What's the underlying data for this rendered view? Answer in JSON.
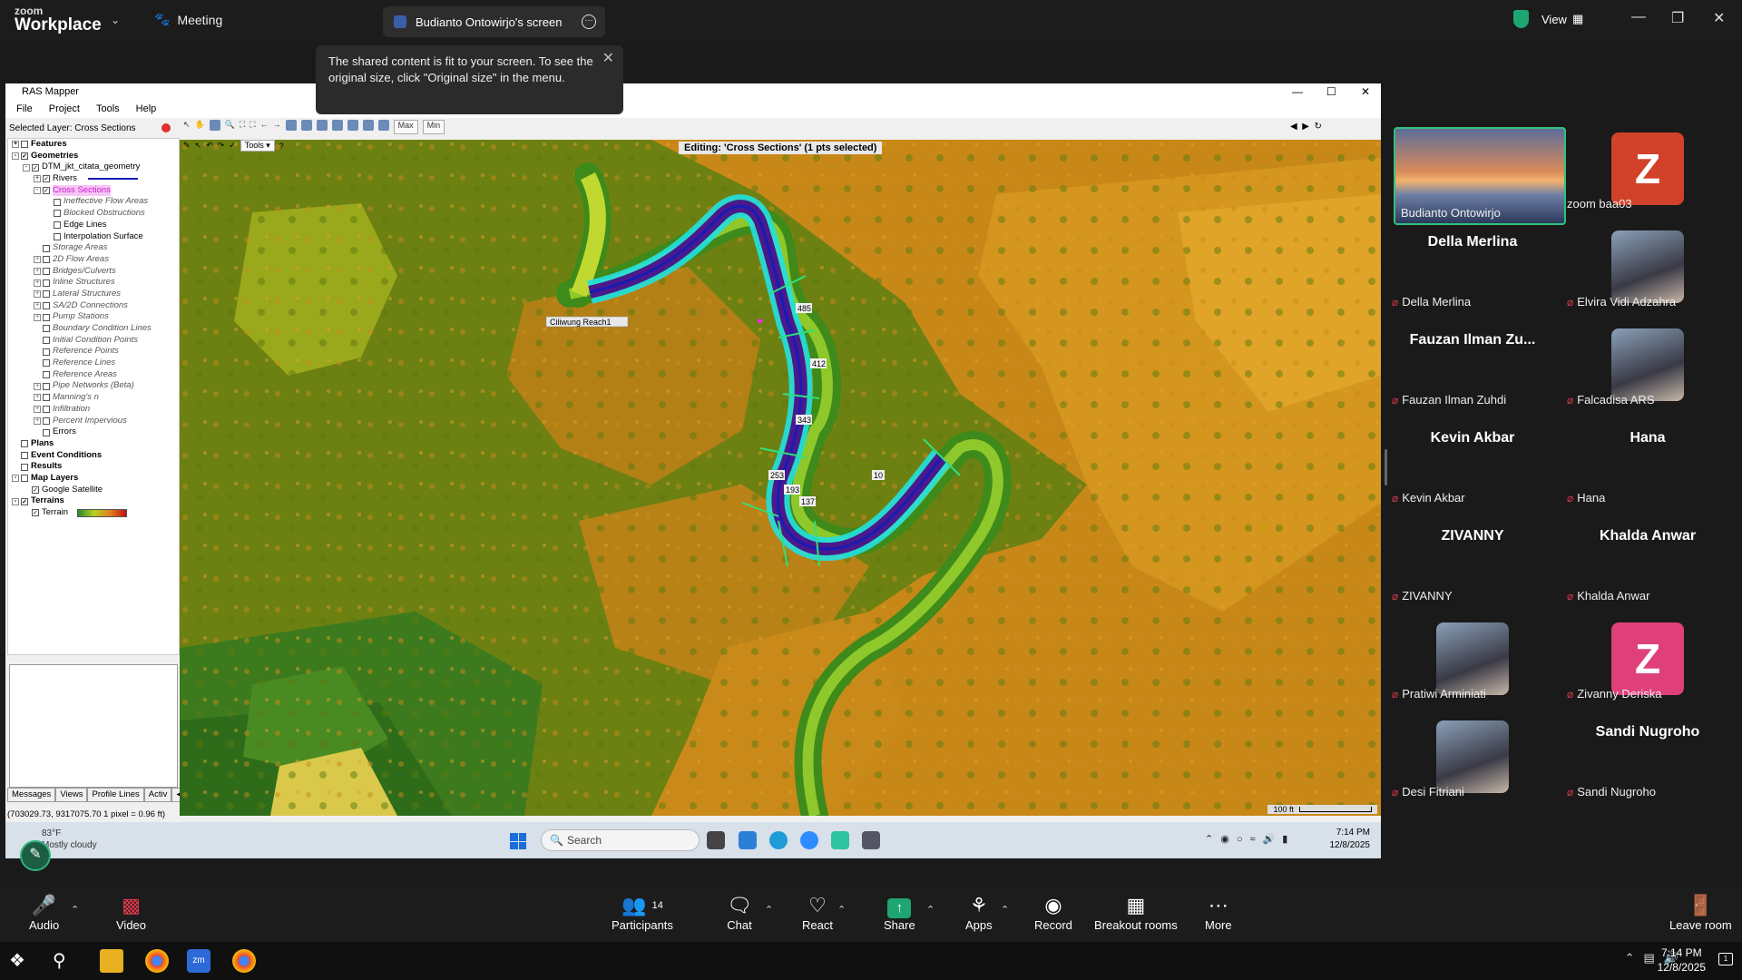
{
  "zoom_top": {
    "logo_top": "zoom",
    "logo_bottom": "Workplace",
    "meeting_label": "Meeting",
    "screen_tab_label": "Budianto Ontowirjo's screen",
    "view_label": "View"
  },
  "tooltip": {
    "text": "The shared content is fit to your screen. To see the original size, click \"Original size\" in the menu."
  },
  "ras": {
    "title": "RAS Mapper",
    "menu": [
      "File",
      "Project",
      "Tools",
      "Help"
    ],
    "selected_layer": "Selected Layer: Cross Sections",
    "tools_label": "Tools",
    "max_label": "Max",
    "min_label": "Min",
    "editing_label": "Editing: 'Cross Sections' (1 pts selected)",
    "scale_label": "100 ft",
    "coords": "(703029.73, 9317075.70  1 pixel = 0.96 ft)",
    "bottom_tabs": [
      "Messages",
      "Views",
      "Profile Lines",
      "Activ"
    ],
    "tree": [
      {
        "label": "Features",
        "indent": 0,
        "style": "bold",
        "toggle": "+",
        "checked": false
      },
      {
        "label": "Geometries",
        "indent": 0,
        "style": "bold",
        "toggle": "-",
        "checked": true
      },
      {
        "label": "DTM_jkt_citata_geometry",
        "indent": 1,
        "style": "",
        "toggle": "-",
        "checked": true
      },
      {
        "label": "Rivers",
        "indent": 2,
        "style": "",
        "toggle": "+",
        "checked": true,
        "swatch": "line"
      },
      {
        "label": "Cross Sections",
        "indent": 2,
        "style": "pink",
        "toggle": "-",
        "checked": true
      },
      {
        "label": "Ineffective Flow Areas",
        "indent": 3,
        "style": "ital",
        "toggle": "",
        "checked": false
      },
      {
        "label": "Blocked Obstructions",
        "indent": 3,
        "style": "ital",
        "toggle": "",
        "checked": false
      },
      {
        "label": "Edge Lines",
        "indent": 3,
        "style": "",
        "toggle": "",
        "checked": false
      },
      {
        "label": "Interpolation Surface",
        "indent": 3,
        "style": "",
        "toggle": "",
        "checked": false
      },
      {
        "label": "Storage Areas",
        "indent": 2,
        "style": "ital",
        "toggle": "",
        "checked": false
      },
      {
        "label": "2D Flow Areas",
        "indent": 2,
        "style": "ital",
        "toggle": "+",
        "checked": false
      },
      {
        "label": "Bridges/Culverts",
        "indent": 2,
        "style": "ital",
        "toggle": "+",
        "checked": false
      },
      {
        "label": "Inline Structures",
        "indent": 2,
        "style": "ital",
        "toggle": "+",
        "checked": false
      },
      {
        "label": "Lateral Structures",
        "indent": 2,
        "style": "ital",
        "toggle": "+",
        "checked": false
      },
      {
        "label": "SA/2D Connections",
        "indent": 2,
        "style": "ital",
        "toggle": "+",
        "checked": false
      },
      {
        "label": "Pump Stations",
        "indent": 2,
        "style": "ital",
        "toggle": "+",
        "checked": false
      },
      {
        "label": "Boundary Condition Lines",
        "indent": 2,
        "style": "ital",
        "toggle": "",
        "checked": false
      },
      {
        "label": "Initial Condition Points",
        "indent": 2,
        "style": "ital",
        "toggle": "",
        "checked": false
      },
      {
        "label": "Reference Points",
        "indent": 2,
        "style": "ital",
        "toggle": "",
        "checked": false
      },
      {
        "label": "Reference Lines",
        "indent": 2,
        "style": "ital",
        "toggle": "",
        "checked": false
      },
      {
        "label": "Reference Areas",
        "indent": 2,
        "style": "ital",
        "toggle": "",
        "checked": false
      },
      {
        "label": "Pipe Networks (Beta)",
        "indent": 2,
        "style": "ital",
        "toggle": "+",
        "checked": false
      },
      {
        "label": "Manning's n",
        "indent": 2,
        "style": "ital",
        "toggle": "+",
        "checked": false
      },
      {
        "label": "Infiltration",
        "indent": 2,
        "style": "ital",
        "toggle": "+",
        "checked": false
      },
      {
        "label": "Percent Impervious",
        "indent": 2,
        "style": "ital",
        "toggle": "+",
        "checked": false
      },
      {
        "label": "Errors",
        "indent": 2,
        "style": "",
        "toggle": "",
        "checked": false
      },
      {
        "label": "Plans",
        "indent": 0,
        "style": "bold",
        "toggle": "",
        "checked": false
      },
      {
        "label": "Event Conditions",
        "indent": 0,
        "style": "bold",
        "toggle": "",
        "checked": false
      },
      {
        "label": "Results",
        "indent": 0,
        "style": "bold",
        "toggle": "",
        "checked": false
      },
      {
        "label": "Map Layers",
        "indent": 0,
        "style": "bold",
        "toggle": "-",
        "checked": false
      },
      {
        "label": "Google Satellite",
        "indent": 1,
        "style": "",
        "toggle": "",
        "checked": true
      },
      {
        "label": "Terrains",
        "indent": 0,
        "style": "bold",
        "toggle": "-",
        "checked": true
      },
      {
        "label": "Terrain",
        "indent": 1,
        "style": "",
        "toggle": "",
        "checked": true,
        "swatch": "grad"
      }
    ],
    "river_label": "Ciliwung Reach1",
    "station_labels": [
      "485",
      "412",
      "343",
      "253",
      "193",
      "137",
      "10"
    ]
  },
  "inner_taskbar": {
    "temp": "83°F",
    "weather": "Mostly cloudy",
    "search": "Search",
    "time": "7:14 PM",
    "date": "12/8/2025"
  },
  "participants": [
    {
      "name": "Budianto Ontowirjo",
      "type": "active"
    },
    {
      "name": "zoom baa03",
      "type": "avatar",
      "letter": "Z",
      "color": "#d2422a",
      "muted": false
    },
    {
      "name": "Della Merlina",
      "type": "text",
      "muted": true
    },
    {
      "name": "Elvira Vidi Adzahra",
      "type": "photo",
      "muted": true
    },
    {
      "name": "Fauzan Ilman Zuhdi",
      "bigname": "Fauzan Ilman Zu...",
      "type": "text",
      "muted": true
    },
    {
      "name": "Falcadisa ARS",
      "type": "photo",
      "muted": true
    },
    {
      "name": "Kevin Akbar",
      "type": "text",
      "muted": true
    },
    {
      "name": "Hana",
      "type": "text",
      "muted": true
    },
    {
      "name": "ZIVANNY",
      "type": "text",
      "muted": true
    },
    {
      "name": "Khalda Anwar",
      "type": "text",
      "muted": true
    },
    {
      "name": "Pratiwi Arminiati",
      "type": "photo",
      "muted": true
    },
    {
      "name": "Zivanny Deriska",
      "type": "avatar",
      "letter": "Z",
      "color": "#e0407a",
      "muted": true
    },
    {
      "name": "Desi Fitriani",
      "type": "photo",
      "muted": true
    },
    {
      "name": "Sandi Nugroho",
      "type": "text",
      "muted": true
    }
  ],
  "zoom_bottom": {
    "audio": "Audio",
    "video": "Video",
    "participants": "Participants",
    "participant_count": "14",
    "chat": "Chat",
    "react": "React",
    "share": "Share",
    "apps": "Apps",
    "record": "Record",
    "breakout": "Breakout rooms",
    "more": "More",
    "leave": "Leave room"
  },
  "taskbar": {
    "time": "7:14 PM",
    "date": "12/8/2025"
  }
}
